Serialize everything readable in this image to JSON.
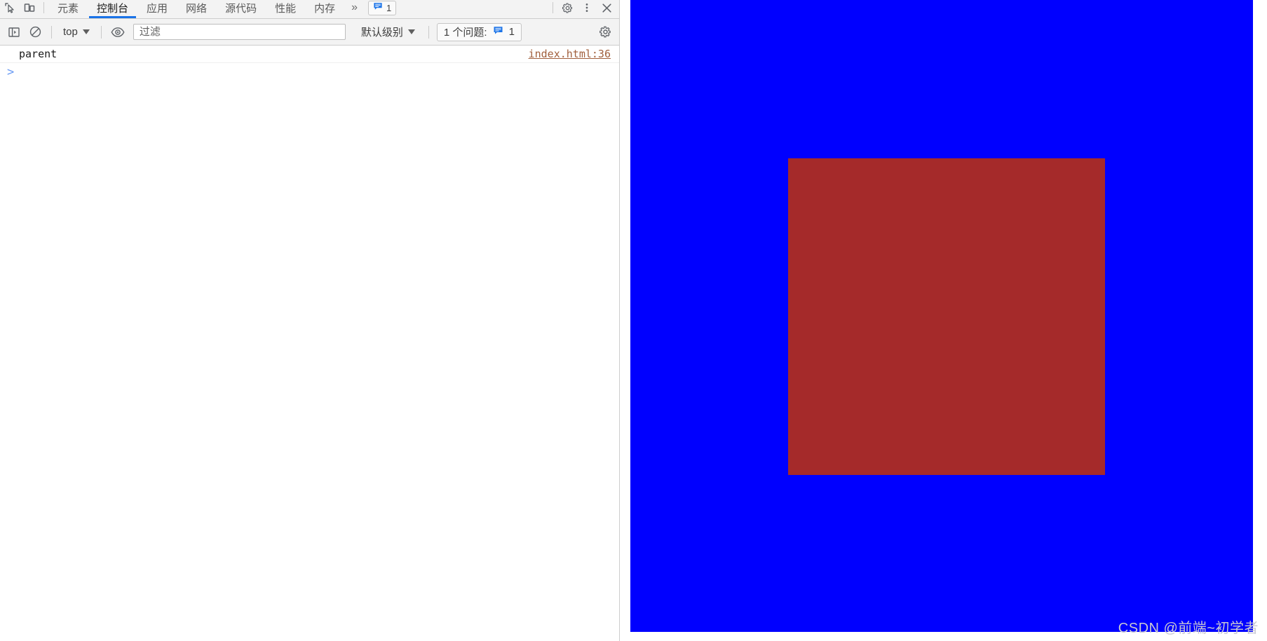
{
  "devtools": {
    "tabstrip": {
      "inspect_icon": "inspect-element-icon",
      "device_icon": "device-toolbar-icon",
      "tabs": [
        {
          "id": "elements",
          "label": "元素",
          "active": false
        },
        {
          "id": "console",
          "label": "控制台",
          "active": true
        },
        {
          "id": "application",
          "label": "应用",
          "active": false
        },
        {
          "id": "network",
          "label": "网络",
          "active": false
        },
        {
          "id": "sources",
          "label": "源代码",
          "active": false
        },
        {
          "id": "performance",
          "label": "性能",
          "active": false
        },
        {
          "id": "memory",
          "label": "内存",
          "active": false
        }
      ],
      "more_tabs_label": "»",
      "issues_chip": {
        "icon": "message-badge-icon",
        "count": "1"
      },
      "settings_icon": "gear-icon",
      "menu_icon": "kebab-menu-icon",
      "close_icon": "close-icon"
    },
    "toolbar": {
      "sidebar_toggle_icon": "console-sidebar-icon",
      "clear_console_icon": "clear-console-icon",
      "context_label": "top",
      "eye_icon": "live-expression-eye-icon",
      "filter_placeholder": "过滤",
      "filter_value": "",
      "level_label": "默认级别",
      "issues_label": "1 个问题:",
      "issues_icon": "message-badge-icon",
      "issues_count": "1",
      "settings_icon": "console-settings-gear-icon"
    },
    "console": {
      "messages": [
        {
          "text": "parent",
          "source": "index.html:36"
        }
      ],
      "prompt_caret": ">",
      "prompt_value": ""
    }
  },
  "page": {
    "blue_container": {
      "name": "parent-blue-box",
      "color": "#0000ff"
    },
    "red_box": {
      "name": "child-red-box",
      "color": "#a52a2a"
    },
    "watermark": "CSDN @前端~初学者"
  },
  "colors": {
    "accent": "#1a73e8",
    "panel_bg": "#f3f3f3",
    "border": "#cdcdcd",
    "blue": "#0000ff",
    "brown_red": "#a52a2a",
    "source_link": "#a15f3c"
  }
}
